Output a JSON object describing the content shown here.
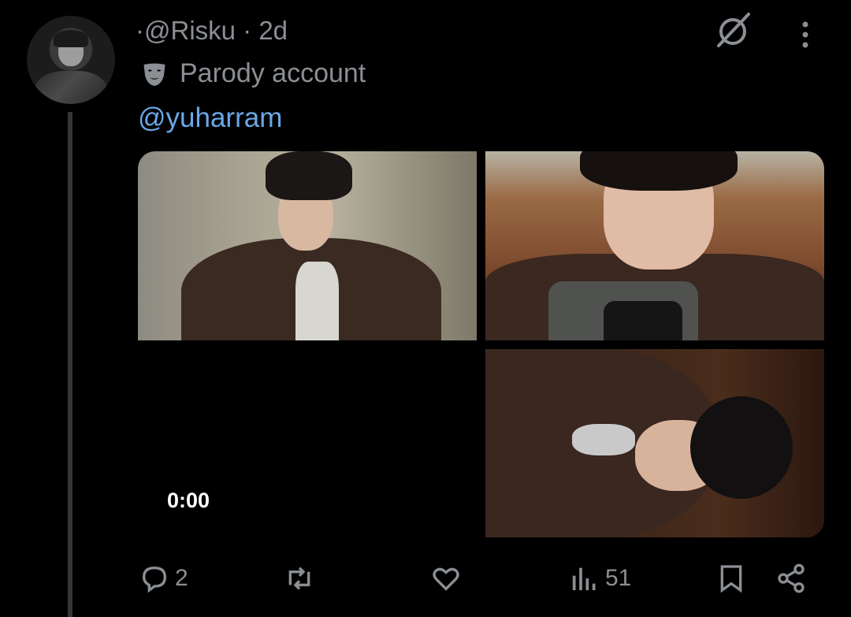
{
  "tweet": {
    "handle_line": "·@Risku · 2d",
    "parody_label": "Parody account",
    "mention": "@yuharram",
    "video_duration": "0:00"
  },
  "actions": {
    "replies": "2",
    "retweets": "",
    "likes": "",
    "views": "51"
  },
  "icons": {
    "grok": "grok-icon",
    "more": "more-vertical-icon",
    "parody": "theater-mask-icon",
    "reply": "reply-icon",
    "retweet": "retweet-icon",
    "like": "heart-icon",
    "views": "views-icon",
    "bookmark": "bookmark-icon",
    "share": "share-icon"
  },
  "colors": {
    "background": "#000000",
    "muted_text": "#8b8f94",
    "link": "#6aa8e8",
    "thread_line": "#333639"
  }
}
